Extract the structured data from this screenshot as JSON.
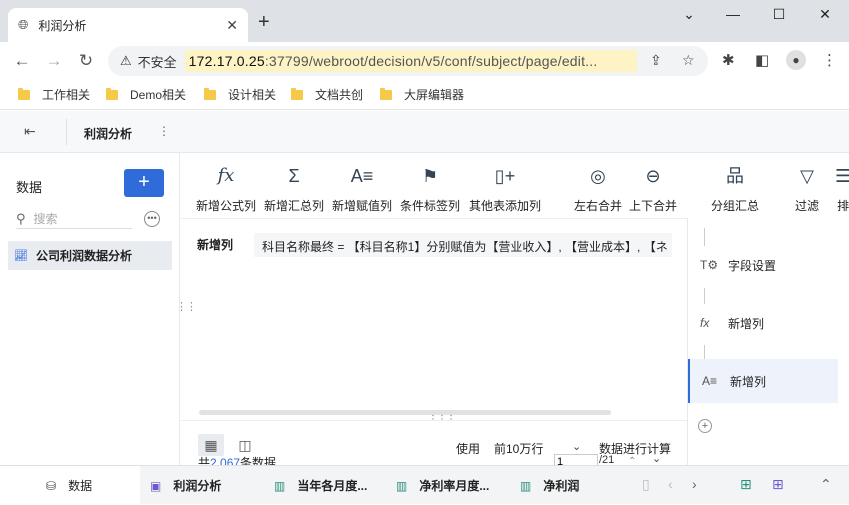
{
  "browser": {
    "tab_title": "利润分析",
    "close_glyph": "✕",
    "new_tab_glyph": "+",
    "security_label": "不安全",
    "url_host": "172.17.0.25",
    "url_path": ":37799/webroot/decision/v5/conf/subject/page/edit..."
  },
  "bookmarks": [
    "工作相关",
    "Demo相关",
    "设计相关",
    "文档共创",
    "大屏编辑器"
  ],
  "app": {
    "title": "利润分析",
    "more_glyph": "⋮"
  },
  "left": {
    "label": "数据",
    "add_glyph": "+",
    "search_placeholder": "搜索",
    "table_name": "公司利润数据分析"
  },
  "ribbon": [
    {
      "icon": "fx-icon",
      "glyph": "fx",
      "label": "新增公式列"
    },
    {
      "icon": "sigma-icon",
      "glyph": "Σ",
      "label": "新增汇总列"
    },
    {
      "icon": "assign-icon",
      "glyph": "A≡",
      "label": "新增赋值列"
    },
    {
      "icon": "flag-icon",
      "glyph": "⚑",
      "label": "条件标签列"
    },
    {
      "icon": "add-column-icon",
      "glyph": "▯+",
      "label": "其他表添加列"
    },
    {
      "icon": "left-right-merge-icon",
      "glyph": "◎",
      "label": "左右合并"
    },
    {
      "icon": "up-down-merge-icon",
      "glyph": "⊖",
      "label": "上下合并"
    },
    {
      "icon": "group-icon",
      "glyph": "品",
      "label": "分组汇总"
    },
    {
      "icon": "filter-icon",
      "glyph": "▽",
      "label": "过滤"
    },
    {
      "icon": "sort-icon",
      "glyph": "☰",
      "label": "排"
    }
  ],
  "formula": {
    "label": "新增列",
    "text": "科目名称最终 = 【科目名称1】分别赋值为【营业收入】, 【营业成本】, 【ネ"
  },
  "preview": {
    "total_prefix": "共",
    "total_count": "2,067",
    "total_suffix": "条数据",
    "use_label": "使用",
    "row_select": "前10万行",
    "calc_label": "数据进行计算",
    "page_value": "1",
    "page_total": "/21"
  },
  "steps": [
    {
      "icon": "field-settings-icon",
      "glyph": "T⚙",
      "label": "字段设置"
    },
    {
      "icon": "fx-icon",
      "glyph": "fx",
      "label": "新增列"
    },
    {
      "icon": "assign-icon",
      "glyph": "A≡",
      "label": "新增列"
    }
  ],
  "bottom_tabs": {
    "data_label": "数据",
    "tabs": [
      "利润分析",
      "当年各月度...",
      "净利率月度...",
      "净利润"
    ]
  }
}
